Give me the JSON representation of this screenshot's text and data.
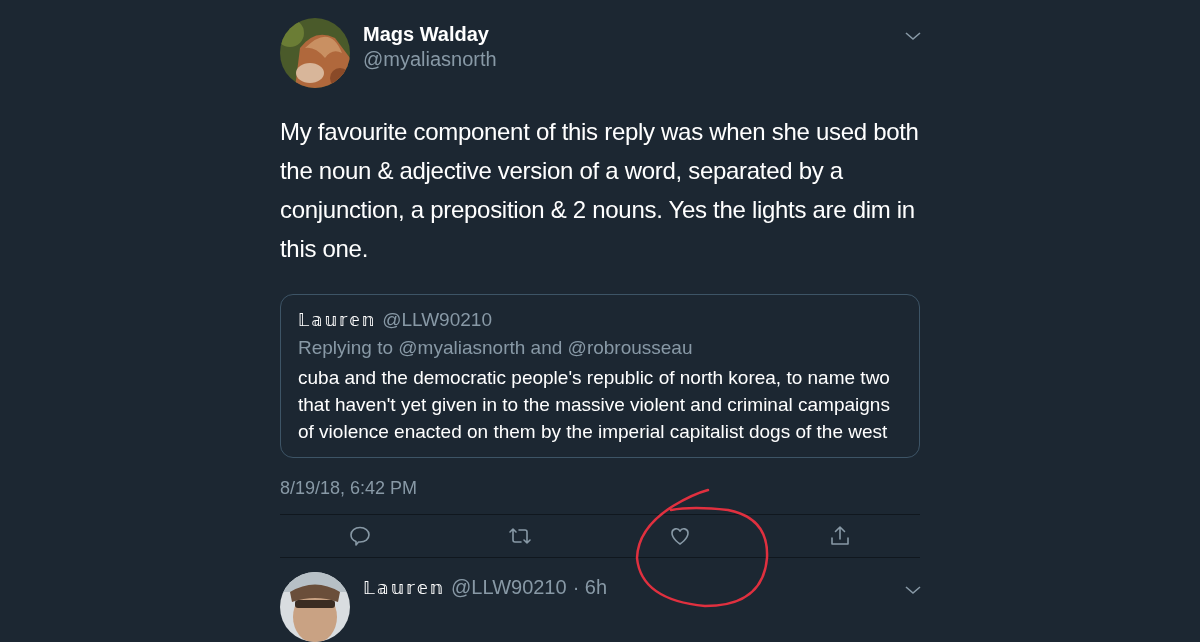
{
  "tweet": {
    "name": "Mags Walday",
    "handle": "@myaliasnorth",
    "text": "My favourite component of this reply was when she used both the noun & adjective version of a word, separated by a conjunction, a preposition & 2 nouns. Yes the lights are dim in this one.",
    "quote": {
      "name": "𝕃𝕒𝕦𝕣𝕖𝕟",
      "handle": "@LLW90210",
      "replying": "Replying to @myaliasnorth and @robrousseau",
      "text": "cuba and the democratic people's republic of north korea, to name two that haven't yet given in to the massive violent and criminal campaigns of violence enacted on them by the imperial capitalist dogs of the west"
    },
    "timestamp": "8/19/18, 6:42 PM",
    "actions": [
      {
        "kind": "reply"
      },
      {
        "kind": "retweet"
      },
      {
        "kind": "like"
      },
      {
        "kind": "share"
      }
    ]
  },
  "annotation": {
    "kind": "circle",
    "color": "#e0303f"
  },
  "next_reply": {
    "name": "𝕃𝕒𝕦𝕣𝕖𝕟",
    "handle": "@LLW90210",
    "time": "· 6h"
  }
}
